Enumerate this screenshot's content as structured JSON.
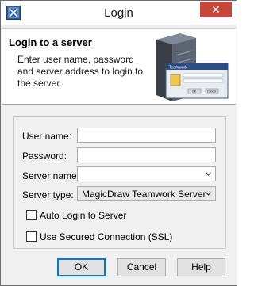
{
  "window": {
    "title": "Login",
    "close_glyph": "✕"
  },
  "banner": {
    "heading": "Login to a server",
    "description": "Enter user name, password and server address to login to the server.",
    "art": {
      "dialog_title": "Teamwork",
      "ok": "OK",
      "cancel": "Cancel"
    }
  },
  "form": {
    "username": {
      "label": "User name:",
      "value": ""
    },
    "password": {
      "label": "Password:",
      "value": ""
    },
    "server_name": {
      "label": "Server name:",
      "value": ""
    },
    "server_type": {
      "label": "Server type:",
      "value": "MagicDraw Teamwork Server"
    },
    "auto_login": {
      "label": "Auto Login to Server",
      "checked": false
    },
    "secured": {
      "label": "Use Secured Connection (SSL)",
      "checked": false
    }
  },
  "buttons": {
    "ok": "OK",
    "cancel": "Cancel",
    "help": "Help"
  },
  "colors": {
    "close": "#c7463b",
    "default_button_border": "#0078d7"
  },
  "icons": {
    "app": "magicdraw-app-icon",
    "close": "close-icon",
    "chevron": "chevron-down-icon",
    "server": "server-icon"
  }
}
